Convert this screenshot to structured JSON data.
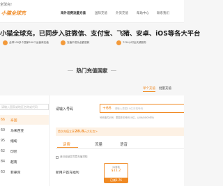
{
  "topbar": {
    "text": "全球充!"
  },
  "header": {
    "logo": "小猫全球充",
    "nav": [
      {
        "label": "海外话费流量充值"
      },
      {
        "label": "国际充值"
      },
      {
        "label": "外资充值"
      },
      {
        "label": "帮助中心"
      },
      {
        "label": "联系我们"
      }
    ]
  },
  "hero": {
    "title": "小猫全球充，已同步入驻微信、支付宝、飞猪、安卓、iOS等各大平台",
    "features": [
      {
        "icon": "globe-icon",
        "text": "全球100多个国家500个运营商充值"
      },
      {
        "icon": "shield-icon",
        "text": "充值不成功全额退款"
      },
      {
        "icon": "clock-icon",
        "text": "7*24小时全天候服务"
      }
    ]
  },
  "section": {
    "title": "热门充值国家"
  },
  "region_tabs": [
    {
      "label": "单个充值"
    },
    {
      "label": "批量充值"
    }
  ],
  "country_list": {
    "search_placeholder": "请输入国家或地区名称或代码",
    "items": [
      {
        "code": "66",
        "name": "泰国",
        "selected": true
      },
      {
        "code": "60",
        "name": "马来西亚",
        "selected": false
      },
      {
        "code": "95",
        "name": "缅甸",
        "selected": false
      },
      {
        "code": "62",
        "name": "印尼",
        "selected": false
      },
      {
        "code": "84",
        "name": "越南",
        "selected": false
      },
      {
        "code": "63",
        "name": "菲律宾",
        "selected": false
      }
    ]
  },
  "form": {
    "phone_label": "请输入号码",
    "country_code": "+66",
    "phone_placeholder": "请输入泰国10位手机号码",
    "hint": "号码格式示例：泰国手机号码10位，以06/08/09开头",
    "promo_prefix": "首次充值立享",
    "promo_amount": "28.8",
    "promo_suffix": "元大礼包>",
    "product_tabs": [
      {
        "label": "话费"
      },
      {
        "label": "流量"
      },
      {
        "label": "语音"
      }
    ],
    "checkbox_text": "我已阅读并同意充值须知",
    "offer_label": "新用户首充福利",
    "offer": {
      "original": "50泰铢",
      "price": "$11.2",
      "discount": "已减1.76"
    }
  },
  "colors": {
    "accent": "#f08a24",
    "background": "#f6f6f6"
  }
}
